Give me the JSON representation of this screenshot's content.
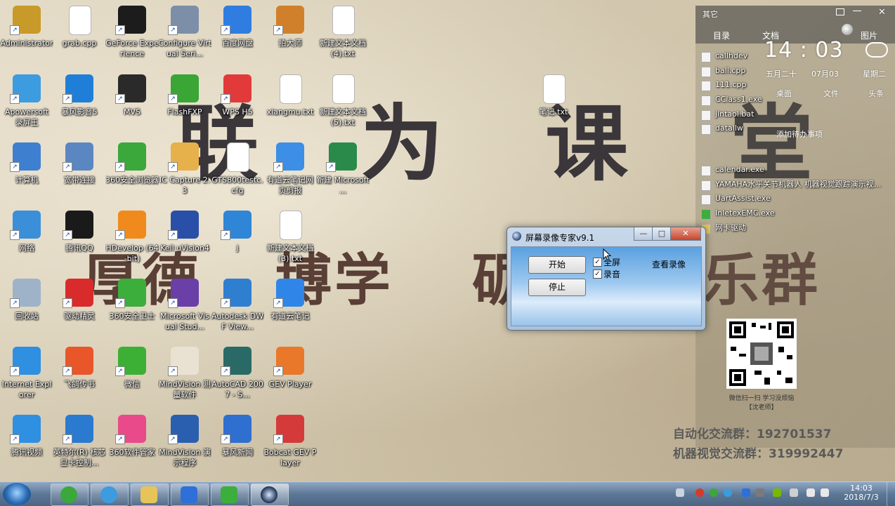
{
  "wallpaper": {
    "title": "联 为 课 堂",
    "motto_1": "厚德",
    "motto_2": "博学",
    "motto_3": "砺",
    "motto_4": "乐群",
    "qq_group_1": "自动化交流群：192701537",
    "qq_group_2": "机器视觉交流群：319992447",
    "qr_caption_1": "微信扫一扫 学习没烦恼",
    "qr_caption_2": "【沈老师】"
  },
  "desktop_icons": [
    {
      "label": "Administrator",
      "icon": "user-folder-icon",
      "color": "#c89a2a"
    },
    {
      "label": "grab.cpp",
      "icon": "cpp-file-icon",
      "color": "#ffffff"
    },
    {
      "label": "GeForce Experience",
      "icon": "nvidia-icon",
      "color": "#1c1c1c"
    },
    {
      "label": "Configure Virtual Seri...",
      "icon": "serial-port-icon",
      "color": "#7d8fa8"
    },
    {
      "label": "百度网盘",
      "icon": "baidu-netdisk-icon",
      "color": "#2f7de1"
    },
    {
      "label": "拍大师",
      "icon": "paidashi-icon",
      "color": "#d0802a"
    },
    {
      "label": "新建文本文档 (4).txt",
      "icon": "text-file-icon",
      "color": "#ffffff"
    },
    {
      "label": "Apowersoft 录屏王",
      "icon": "apowersoft-icon",
      "color": "#3d9be0"
    },
    {
      "label": "暴风影音5",
      "icon": "baofeng-icon",
      "color": "#1f7fd8"
    },
    {
      "label": "MVS",
      "icon": "mvs-icon",
      "color": "#2a2a2a"
    },
    {
      "label": "FlashFXP",
      "icon": "flashfxp-icon",
      "color": "#3aa636"
    },
    {
      "label": "WPS H5",
      "icon": "wps-icon",
      "color": "#e23a3a"
    },
    {
      "label": "xiangmu.txt",
      "icon": "text-file-icon",
      "color": "#ffffff"
    },
    {
      "label": "新建文本文档 (5).txt",
      "icon": "text-file-icon",
      "color": "#ffffff"
    },
    {
      "label": "笔记.txt",
      "icon": "text-file-icon",
      "color": "#ffffff"
    },
    {
      "label": "计算机",
      "icon": "computer-icon",
      "color": "#3f7fcf"
    },
    {
      "label": "宽带连接",
      "icon": "network-connection-icon",
      "color": "#5a86c2"
    },
    {
      "label": "360安全浏览器",
      "icon": "360-browser-icon",
      "color": "#3aa83a"
    },
    {
      "label": "IC Capture 2.3",
      "icon": "ic-capture-icon",
      "color": "#e6b04a"
    },
    {
      "label": "GTS800testc.cfg",
      "icon": "cfg-file-icon",
      "color": "#ffffff"
    },
    {
      "label": "有道云笔记网页剪报",
      "icon": "youdao-clip-icon",
      "color": "#3c8ee6"
    },
    {
      "label": "新建 Microsoft ...",
      "icon": "excel-icon",
      "color": "#2a8a4a"
    },
    {
      "label": "网络",
      "icon": "network-icon",
      "color": "#3a8fd8"
    },
    {
      "label": "腾讯QQ",
      "icon": "qq-icon",
      "color": "#1a1a1a"
    },
    {
      "label": "HDevelop (64-bit)",
      "icon": "hdevelop-icon",
      "color": "#f08a1c"
    },
    {
      "label": "Keil uVision4",
      "icon": "keil-icon",
      "color": "#2a4fa8"
    },
    {
      "label": "j",
      "icon": "j-app-icon",
      "color": "#2f86d6"
    },
    {
      "label": "新建文本文档 (3).txt",
      "icon": "text-file-icon",
      "color": "#ffffff"
    },
    {
      "label": "回收站",
      "icon": "recycle-bin-icon",
      "color": "#9fb3c8"
    },
    {
      "label": "驱动精灵",
      "icon": "driver-genius-icon",
      "color": "#d92b2b"
    },
    {
      "label": "360安全卫士",
      "icon": "360-safe-icon",
      "color": "#3cae3c"
    },
    {
      "label": "Microsoft Visual Stud...",
      "icon": "visual-studio-icon",
      "color": "#6a3fa8"
    },
    {
      "label": "Autodesk DWF View...",
      "icon": "autodesk-icon",
      "color": "#2f7fd0"
    },
    {
      "label": "有道云笔记",
      "icon": "youdao-note-icon",
      "color": "#2f86e8"
    },
    {
      "label": "Internet Explorer",
      "icon": "ie-icon",
      "color": "#2f8fe0"
    },
    {
      "label": "飞鸽传书",
      "icon": "feige-icon",
      "color": "#e8562a"
    },
    {
      "label": "微信",
      "icon": "wechat-icon",
      "color": "#3cb034"
    },
    {
      "label": "MindVision 测量软件",
      "icon": "mindvision-icon",
      "color": "#e9e2d2"
    },
    {
      "label": "AutoCAD 2007 - S...",
      "icon": "autocad-icon",
      "color": "#2a6a66"
    },
    {
      "label": "GEV Player",
      "icon": "gev-player-icon",
      "color": "#e9782a"
    },
    {
      "label": "腾讯视频",
      "icon": "tencent-video-icon",
      "color": "#2f8fe0"
    },
    {
      "label": "英特尔(R) 核芯显卡控制...",
      "icon": "intel-graphics-icon",
      "color": "#2a7ad0"
    },
    {
      "label": "360软件管家",
      "icon": "360-software-icon",
      "color": "#e84a8a"
    },
    {
      "label": "MindVision 演示程序",
      "icon": "mindvision-demo-icon",
      "color": "#2a5fb0"
    },
    {
      "label": "暴风新闻",
      "icon": "baofeng-news-icon",
      "color": "#2f6fd0"
    },
    {
      "label": "Bobcat GEV Player",
      "icon": "bobcat-icon",
      "color": "#d43a3a"
    }
  ],
  "side_panel": {
    "tab_other": "其它",
    "tab_catalog": "目录",
    "tab_docs": "文档",
    "tab_pics": "图片",
    "clock": "14 : 03",
    "weekday_cn": "五月二十",
    "date": "07月03",
    "weekday": "星期二",
    "action_desktop": "桌面",
    "action_file": "文件",
    "action_head": "头条",
    "add_todo": "添加待办事项",
    "files": [
      "callhdev",
      "ball.cpp",
      "111.cpp",
      "CClass1.exe",
      "jintaol.bat",
      "datallw",
      "calendar.exe",
      "YAMAHA水平关节机器人 机器视觉跟踪演示视...",
      "UartAssist.exe",
      "InletexEMC.exe",
      "网卡驱动"
    ]
  },
  "recorder_window": {
    "title": "屏幕录像专家v9.1",
    "minimize": "—",
    "maximize": "□",
    "close": "✕",
    "start_label": "开始",
    "stop_label": "停止",
    "fullscreen_label": "全屏",
    "fullscreen_checked": true,
    "audio_label": "录音",
    "audio_checked": true,
    "view_label": "查看录像"
  },
  "taskbar": {
    "time": "14:03",
    "date": "2018/7/3",
    "apps": [
      "360-browser-icon",
      "apowersoft-icon",
      "explorer-icon",
      "wps-icon",
      "libreoffice-icon",
      "recorder-icon"
    ]
  }
}
